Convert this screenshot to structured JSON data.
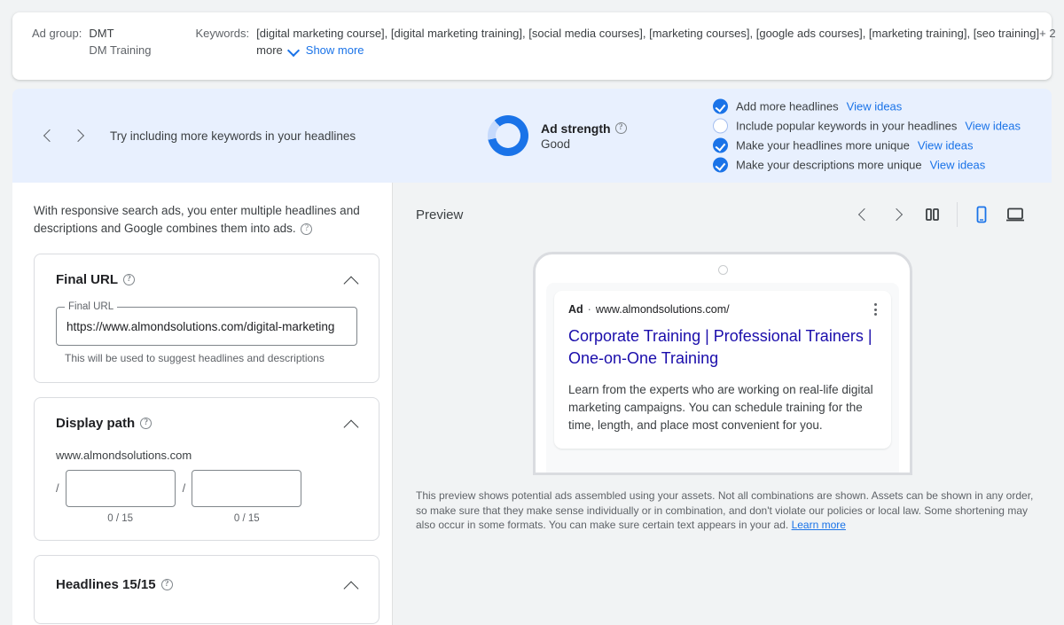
{
  "adgroup": {
    "label": "Ad group:",
    "name": "DMT",
    "sub": "DM Training"
  },
  "keywords": {
    "label": "Keywords:",
    "list": "[digital marketing course], [digital marketing training], [social media courses], [marketing courses], [google ads courses], [marketing training], [seo training]",
    "overflow": "+ 2",
    "more_word": "more",
    "show_more": "Show more"
  },
  "strength": {
    "tip": "Try including more keywords in your headlines",
    "title": "Ad strength",
    "value": "Good",
    "ring_percent": 83,
    "accent_color": "#1a73e8",
    "banner_color": "#e8f0fe",
    "checklist": [
      {
        "label": "Add more headlines",
        "done": true,
        "action": "View ideas"
      },
      {
        "label": "Include popular keywords in your headlines",
        "done": false,
        "action": "View ideas"
      },
      {
        "label": "Make your headlines more unique",
        "done": true,
        "action": "View ideas"
      },
      {
        "label": "Make your descriptions more unique",
        "done": true,
        "action": "View ideas"
      }
    ]
  },
  "editor": {
    "intro": "With responsive search ads, you enter multiple headlines and descriptions and Google combines them into ads.",
    "final_url": {
      "title": "Final URL",
      "field_label": "Final URL",
      "value": "https://www.almondsolutions.com/digital-marketing",
      "hint": "This will be used to suggest headlines and descriptions"
    },
    "display_path": {
      "title": "Display path",
      "domain": "www.almondsolutions.com",
      "slash": "/",
      "path1_value": "",
      "path1_count": "0 / 15",
      "path2_value": "",
      "path2_count": "0 / 15"
    },
    "headlines": {
      "title": "Headlines 15/15"
    }
  },
  "preview": {
    "title": "Preview",
    "device_selected": "mobile",
    "ad": {
      "badge": "Ad",
      "separator": "·",
      "url": "www.almondsolutions.com/",
      "headline": "Corporate Training | Professional Trainers | One-on-One Training",
      "description": "Learn from the experts who are working on real-life digital marketing campaigns. You can schedule training for the time, length, and place most convenient for you."
    },
    "disclaimer": "This preview shows potential ads assembled using your assets. Not all combinations are shown. Assets can be shown in any order, so make sure that they make sense individually or in combination, and don't violate our policies or local law. Some shortening may also occur in some formats. You can make sure certain text appears in your ad.",
    "learn_more": "Learn more"
  }
}
